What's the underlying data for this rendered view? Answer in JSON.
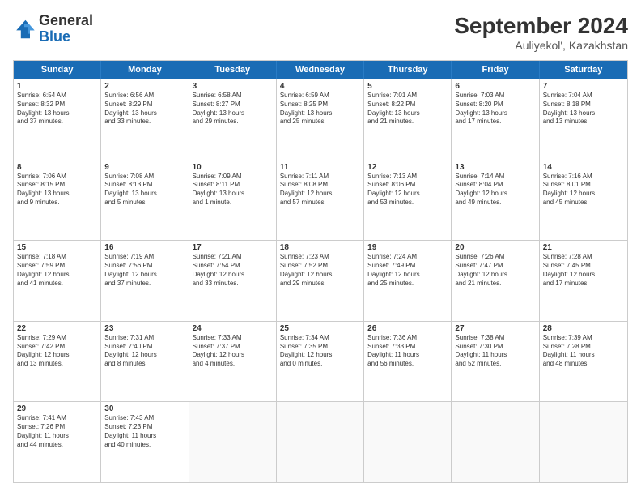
{
  "logo": {
    "line1": "General",
    "line2": "Blue"
  },
  "title": "September 2024",
  "subtitle": "Auliyekol', Kazakhstan",
  "header_days": [
    "Sunday",
    "Monday",
    "Tuesday",
    "Wednesday",
    "Thursday",
    "Friday",
    "Saturday"
  ],
  "rows": [
    [
      {
        "day": "1",
        "text": "Sunrise: 6:54 AM\nSunset: 8:32 PM\nDaylight: 13 hours\nand 37 minutes."
      },
      {
        "day": "2",
        "text": "Sunrise: 6:56 AM\nSunset: 8:29 PM\nDaylight: 13 hours\nand 33 minutes."
      },
      {
        "day": "3",
        "text": "Sunrise: 6:58 AM\nSunset: 8:27 PM\nDaylight: 13 hours\nand 29 minutes."
      },
      {
        "day": "4",
        "text": "Sunrise: 6:59 AM\nSunset: 8:25 PM\nDaylight: 13 hours\nand 25 minutes."
      },
      {
        "day": "5",
        "text": "Sunrise: 7:01 AM\nSunset: 8:22 PM\nDaylight: 13 hours\nand 21 minutes."
      },
      {
        "day": "6",
        "text": "Sunrise: 7:03 AM\nSunset: 8:20 PM\nDaylight: 13 hours\nand 17 minutes."
      },
      {
        "day": "7",
        "text": "Sunrise: 7:04 AM\nSunset: 8:18 PM\nDaylight: 13 hours\nand 13 minutes."
      }
    ],
    [
      {
        "day": "8",
        "text": "Sunrise: 7:06 AM\nSunset: 8:15 PM\nDaylight: 13 hours\nand 9 minutes."
      },
      {
        "day": "9",
        "text": "Sunrise: 7:08 AM\nSunset: 8:13 PM\nDaylight: 13 hours\nand 5 minutes."
      },
      {
        "day": "10",
        "text": "Sunrise: 7:09 AM\nSunset: 8:11 PM\nDaylight: 13 hours\nand 1 minute."
      },
      {
        "day": "11",
        "text": "Sunrise: 7:11 AM\nSunset: 8:08 PM\nDaylight: 12 hours\nand 57 minutes."
      },
      {
        "day": "12",
        "text": "Sunrise: 7:13 AM\nSunset: 8:06 PM\nDaylight: 12 hours\nand 53 minutes."
      },
      {
        "day": "13",
        "text": "Sunrise: 7:14 AM\nSunset: 8:04 PM\nDaylight: 12 hours\nand 49 minutes."
      },
      {
        "day": "14",
        "text": "Sunrise: 7:16 AM\nSunset: 8:01 PM\nDaylight: 12 hours\nand 45 minutes."
      }
    ],
    [
      {
        "day": "15",
        "text": "Sunrise: 7:18 AM\nSunset: 7:59 PM\nDaylight: 12 hours\nand 41 minutes."
      },
      {
        "day": "16",
        "text": "Sunrise: 7:19 AM\nSunset: 7:56 PM\nDaylight: 12 hours\nand 37 minutes."
      },
      {
        "day": "17",
        "text": "Sunrise: 7:21 AM\nSunset: 7:54 PM\nDaylight: 12 hours\nand 33 minutes."
      },
      {
        "day": "18",
        "text": "Sunrise: 7:23 AM\nSunset: 7:52 PM\nDaylight: 12 hours\nand 29 minutes."
      },
      {
        "day": "19",
        "text": "Sunrise: 7:24 AM\nSunset: 7:49 PM\nDaylight: 12 hours\nand 25 minutes."
      },
      {
        "day": "20",
        "text": "Sunrise: 7:26 AM\nSunset: 7:47 PM\nDaylight: 12 hours\nand 21 minutes."
      },
      {
        "day": "21",
        "text": "Sunrise: 7:28 AM\nSunset: 7:45 PM\nDaylight: 12 hours\nand 17 minutes."
      }
    ],
    [
      {
        "day": "22",
        "text": "Sunrise: 7:29 AM\nSunset: 7:42 PM\nDaylight: 12 hours\nand 13 minutes."
      },
      {
        "day": "23",
        "text": "Sunrise: 7:31 AM\nSunset: 7:40 PM\nDaylight: 12 hours\nand 8 minutes."
      },
      {
        "day": "24",
        "text": "Sunrise: 7:33 AM\nSunset: 7:37 PM\nDaylight: 12 hours\nand 4 minutes."
      },
      {
        "day": "25",
        "text": "Sunrise: 7:34 AM\nSunset: 7:35 PM\nDaylight: 12 hours\nand 0 minutes."
      },
      {
        "day": "26",
        "text": "Sunrise: 7:36 AM\nSunset: 7:33 PM\nDaylight: 11 hours\nand 56 minutes."
      },
      {
        "day": "27",
        "text": "Sunrise: 7:38 AM\nSunset: 7:30 PM\nDaylight: 11 hours\nand 52 minutes."
      },
      {
        "day": "28",
        "text": "Sunrise: 7:39 AM\nSunset: 7:28 PM\nDaylight: 11 hours\nand 48 minutes."
      }
    ],
    [
      {
        "day": "29",
        "text": "Sunrise: 7:41 AM\nSunset: 7:26 PM\nDaylight: 11 hours\nand 44 minutes."
      },
      {
        "day": "30",
        "text": "Sunrise: 7:43 AM\nSunset: 7:23 PM\nDaylight: 11 hours\nand 40 minutes."
      },
      {
        "day": "",
        "text": ""
      },
      {
        "day": "",
        "text": ""
      },
      {
        "day": "",
        "text": ""
      },
      {
        "day": "",
        "text": ""
      },
      {
        "day": "",
        "text": ""
      }
    ]
  ]
}
